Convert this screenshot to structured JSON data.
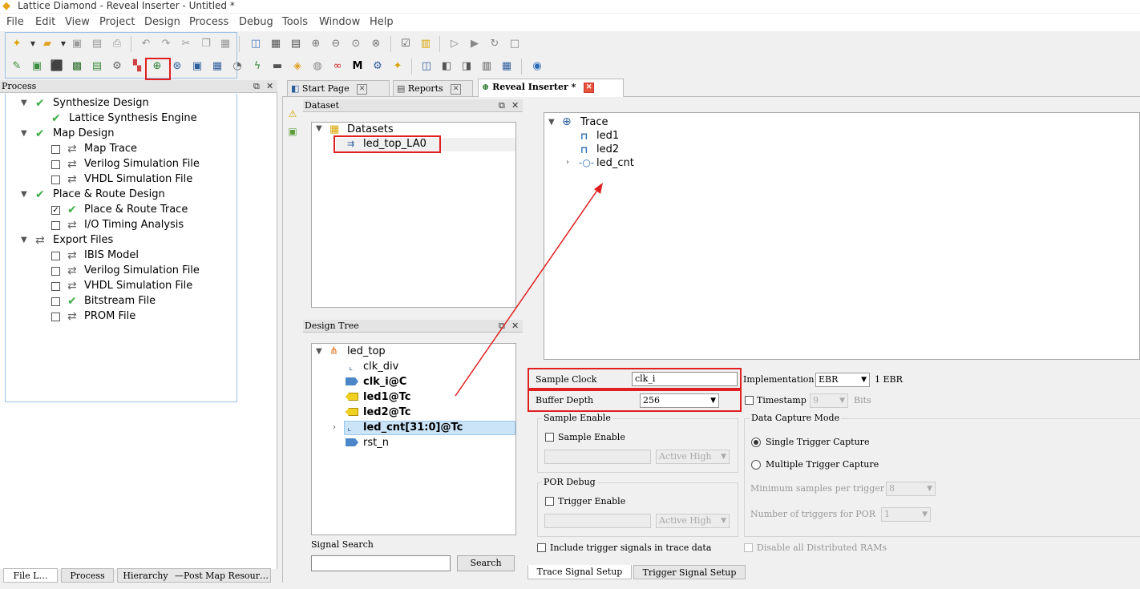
{
  "window": {
    "title": "Lattice Diamond - Reveal Inserter - Untitled *"
  },
  "menu": [
    "File",
    "Edit",
    "View",
    "Project",
    "Design",
    "Process",
    "Debug",
    "Tools",
    "Window",
    "Help"
  ],
  "process_panel": {
    "title": "Process",
    "items": [
      {
        "label": "Synthesize Design",
        "level": 0,
        "status": "check"
      },
      {
        "label": "Lattice Synthesis Engine",
        "level": 1,
        "status": "check"
      },
      {
        "label": "Map Design",
        "level": 0,
        "status": "check"
      },
      {
        "label": "Map Trace",
        "level": 1,
        "status": "refresh"
      },
      {
        "label": "Verilog Simulation File",
        "level": 1,
        "status": "refresh"
      },
      {
        "label": "VHDL Simulation File",
        "level": 1,
        "status": "refresh"
      },
      {
        "label": "Place & Route Design",
        "level": 0,
        "status": "check"
      },
      {
        "label": "Place & Route Trace",
        "level": 1,
        "status": "check",
        "checked": true
      },
      {
        "label": "I/O Timing Analysis",
        "level": 1,
        "status": "refresh"
      },
      {
        "label": "Export Files",
        "level": 0,
        "status": "refresh"
      },
      {
        "label": "IBIS Model",
        "level": 1,
        "status": "refresh"
      },
      {
        "label": "Verilog Simulation File",
        "level": 1,
        "status": "refresh"
      },
      {
        "label": "VHDL Simulation File",
        "level": 1,
        "status": "refresh"
      },
      {
        "label": "Bitstream File",
        "level": 1,
        "status": "check"
      },
      {
        "label": "PROM File",
        "level": 1,
        "status": "refresh"
      }
    ],
    "bottom_tabs": [
      "File L…",
      "Process",
      "Hierarchy",
      "Post Map Resour…"
    ]
  },
  "tabs": [
    {
      "label": "Start Page"
    },
    {
      "label": "Reports"
    },
    {
      "label": "Reveal Inserter *"
    }
  ],
  "dataset_panel": {
    "title": "Dataset",
    "root": "Datasets",
    "item": "led_top_LA0"
  },
  "design_tree_panel": {
    "title": "Design Tree",
    "root": "led_top",
    "items": [
      "clk_div",
      "clk_i@C",
      "led1@Tc",
      "led2@Tc",
      "led_cnt[31:0]@Tc",
      "rst_n"
    ],
    "signal_search_label": "Signal Search",
    "search_button": "Search"
  },
  "trace_tree": {
    "root": "Trace",
    "items": [
      "led1",
      "led2",
      "led_cnt"
    ]
  },
  "settings": {
    "sample_clock_label": "Sample Clock",
    "sample_clock_value": "clk_i",
    "implementation_label": "Implementation",
    "implementation_value": "EBR",
    "ebr_count": "1 EBR",
    "buffer_depth_label": "Buffer Depth",
    "buffer_depth_value": "256",
    "timestamp_label": "Timestamp",
    "timestamp_value": "9",
    "bits_label": "Bits",
    "sample_enable_group": "Sample Enable",
    "sample_enable_label": "Sample Enable",
    "active_high": "Active High",
    "por_debug_group": "POR Debug",
    "trigger_enable_label": "Trigger Enable",
    "data_capture_group": "Data Capture Mode",
    "single_trigger": "Single Trigger Capture",
    "multiple_trigger": "Multiple Trigger Capture",
    "min_samples_label": "Minimum samples per trigger",
    "min_samples_value": "8",
    "num_triggers_label": "Number of triggers for POR",
    "num_triggers_value": "1",
    "include_trigger_label": "Include trigger signals in trace data",
    "disable_rams_label": "Disable all Distributed RAMs"
  },
  "bottom_tabs": [
    "Trace Signal Setup",
    "Trigger Signal Setup"
  ],
  "colors": {
    "highlight_red": "#e02020",
    "check_green": "#3cb043",
    "selection_blue": "#cce4f7"
  }
}
